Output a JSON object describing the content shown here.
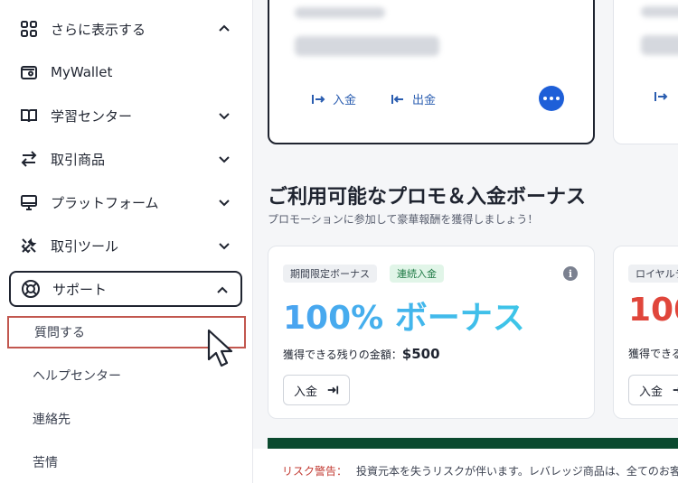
{
  "sidebar": {
    "items": [
      {
        "label": "さらに表示する",
        "icon": "grid-icon",
        "chevron": "up"
      },
      {
        "label": "MyWallet",
        "icon": "wallet-icon",
        "chevron": ""
      },
      {
        "label": "学習センター",
        "icon": "book-icon",
        "chevron": "down"
      },
      {
        "label": "取引商品",
        "icon": "swap-icon",
        "chevron": "down"
      },
      {
        "label": "プラットフォーム",
        "icon": "monitor-icon",
        "chevron": "down"
      },
      {
        "label": "取引ツール",
        "icon": "tools-icon",
        "chevron": "down"
      },
      {
        "label": "サポート",
        "icon": "lifebuoy-icon",
        "chevron": "up"
      }
    ],
    "support_sub": [
      {
        "label": "質問する"
      },
      {
        "label": "ヘルプセンター"
      },
      {
        "label": "連絡先"
      },
      {
        "label": "苦情"
      }
    ]
  },
  "wallet": {
    "deposit_label": "入金",
    "withdraw_label": "出金"
  },
  "promos": {
    "title": "ご利用可能なプロモ＆入金ボーナス",
    "subtitle": "プロモーションに参加して豪華報酬を獲得しましょう！",
    "cards": [
      {
        "badge1": "期間限定ボーナス",
        "badge2": "連続入金",
        "title": "100% ボーナス",
        "remain_label": "獲得できる残りの金額：",
        "remain_value": "$500",
        "button_label": "入金"
      },
      {
        "badge1": "ロイヤルテ",
        "title": "100",
        "remain_label": "獲得できる残",
        "button_label": "入金"
      }
    ]
  },
  "risk": {
    "label": "リスク警告：",
    "text": "投資元本を失うリスクが伴います。レバレッジ商品は、全てのお客様"
  },
  "colors": {
    "accent_blue": "#1e5fd8",
    "promo_gradient_start": "#4aa3f0",
    "promo_red": "#e0463b",
    "active_border": "#1f2430",
    "highlight_border": "#c2574f"
  }
}
